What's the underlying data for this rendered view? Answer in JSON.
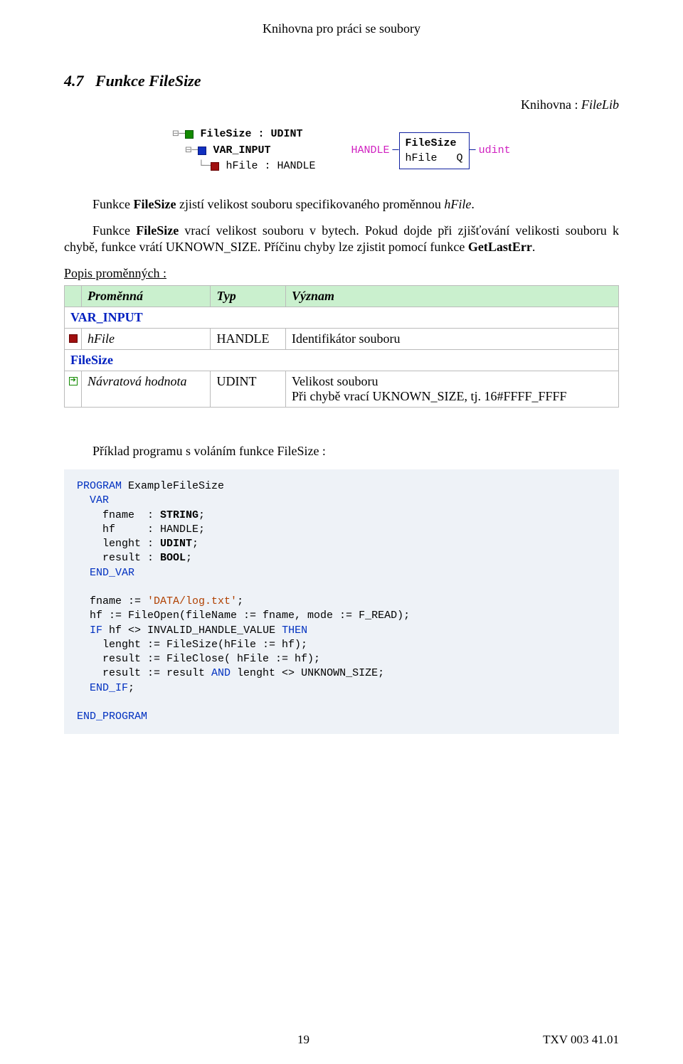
{
  "header": "Knihovna pro práci se soubory",
  "section_number": "4.7",
  "section_title": "Funkce FileSize",
  "lib_label": "Knihovna : ",
  "lib_name": "FileLib",
  "tree": {
    "l1": "FileSize : UDINT",
    "l2": "VAR_INPUT",
    "l3": "hFile : HANDLE"
  },
  "fb": {
    "name": "FileSize",
    "in_label": "HANDLE",
    "in_port": "hFile",
    "out_port": "Q",
    "out_label": "udint"
  },
  "para1_a": "Funkce ",
  "para1_b": "FileSize",
  "para1_c": " zjistí velikost souboru specifikovaného proměnnou ",
  "para1_d": "hFile",
  "para1_e": ".",
  "para2_a": "Funkce ",
  "para2_b": "FileSize",
  "para2_c": " vrací velikost souboru v bytech. Pokud dojde při zjišťování velikosti souboru k chybě, funkce vrátí UKNOWN_SIZE. Příčinu chyby lze zjistit pomocí funkce ",
  "para2_d": "GetLastErr",
  "para2_e": ".",
  "popis": "Popis proměnných :",
  "table": {
    "h1": "Proměnná",
    "h2": "Typ",
    "h3": "Význam",
    "group1": "VAR_INPUT",
    "r1c1": "hFile",
    "r1c2": "HANDLE",
    "r1c3": "Identifikátor souboru",
    "group2": "FileSize",
    "r2c1": "Návratová hodnota",
    "r2c2": "UDINT",
    "r2c3": "Velikost souboru\nPři chybě vrací UKNOWN_SIZE, tj. 16#FFFF_FFFF"
  },
  "example_caption": "Příklad programu s voláním funkce FileSize :",
  "code": {
    "k_program": "PROGRAM",
    "prog_name": " ExampleFileSize",
    "k_var": "VAR",
    "v1_name": "    fname  : ",
    "v1_type": "STRING",
    "v2_name": "    hf     : HANDLE;",
    "v3_name": "    lenght : ",
    "v3_type": "UDINT",
    "v4_name": "    result : ",
    "v4_type": "BOOL",
    "k_endvar": "END_VAR",
    "s1a": "  fname := ",
    "s1b": "'DATA/log.txt'",
    "s1c": ";",
    "s2": "  hf := FileOpen(fileName := fname, mode := F_READ);",
    "k_if": "IF",
    "s3a": " hf <> INVALID_HANDLE_VALUE ",
    "k_then": "THEN",
    "s4": "    lenght := FileSize(hFile := hf);",
    "s5": "    result := FileClose( hFile := hf);",
    "s6a": "    result := result ",
    "k_and": "AND",
    "s6b": " lenght <> UNKNOWN_SIZE;",
    "k_endif": "END_IF",
    "semi": ";",
    "k_endprogram": "END_PROGRAM"
  },
  "footer_left": "19",
  "footer_right": "TXV 003 41.01"
}
